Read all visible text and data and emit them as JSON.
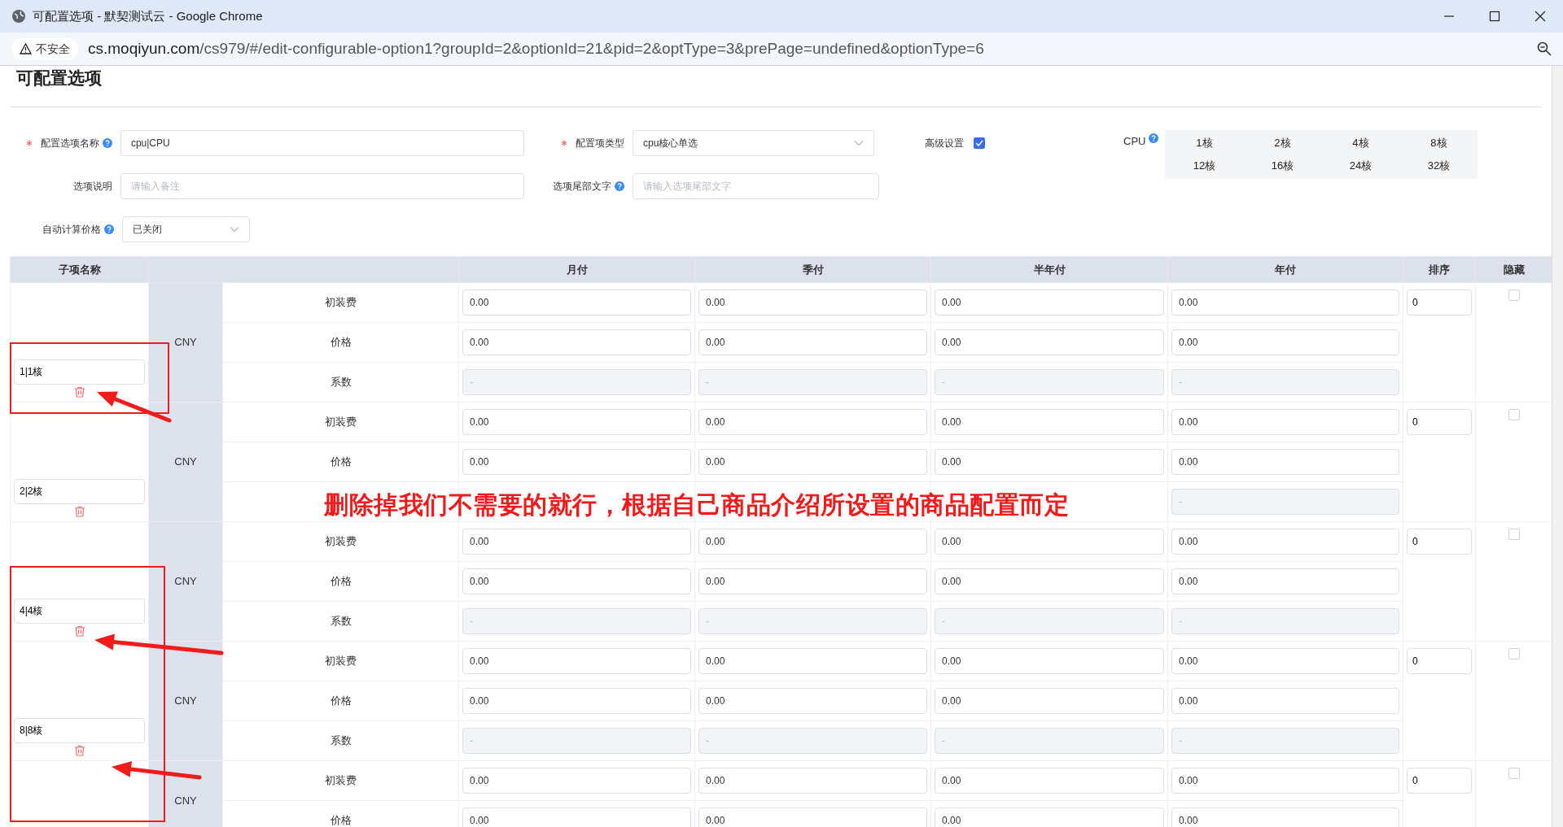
{
  "window": {
    "title": "可配置选项 - 默契测试云 - Google Chrome"
  },
  "address_bar": {
    "security": "不安全",
    "host": "cs.moqiyun.com",
    "path": "/cs979/#/edit-configurable-option1?groupId=2&optionId=21&pid=2&optType=3&prePage=undefined&optionType=6"
  },
  "page": {
    "title": "可配置选项"
  },
  "form": {
    "rows": [
      [
        {
          "kind": "input",
          "label": "配置选项名称",
          "required": true,
          "help": true,
          "value": "cpu|CPU"
        },
        {
          "kind": "select",
          "label": "配置项类型",
          "required": true,
          "help": false,
          "value": "cpu核心单选"
        }
      ],
      [
        {
          "kind": "input",
          "label": "选项说明",
          "required": false,
          "help": false,
          "placeholder": "请输入备注"
        },
        {
          "kind": "input",
          "label": "选项尾部文字",
          "required": false,
          "help": true,
          "placeholder": "请输入选项尾部文字"
        }
      ],
      [
        {
          "kind": "select",
          "label": "自动计算价格",
          "required": false,
          "help": true,
          "value": "已关闭"
        }
      ]
    ],
    "advanced": {
      "label": "高级设置",
      "checked": true
    },
    "cpu": {
      "label": "CPU",
      "help": true,
      "options": [
        "1核",
        "2核",
        "4核",
        "8核",
        "12核",
        "16核",
        "24核",
        "32核"
      ]
    }
  },
  "table": {
    "columns": [
      "子项名称",
      "月付",
      "季付",
      "半年付",
      "年付",
      "排序",
      "隐藏"
    ],
    "groups": [
      {
        "name": "1|1核",
        "currency": "CNY",
        "sort": "0",
        "hidden": false,
        "rows": [
          {
            "kind": "fee",
            "label": "初装费",
            "cells": [
              "0.00",
              "0.00",
              "0.00",
              "0.00"
            ]
          },
          {
            "kind": "fee",
            "label": "价格",
            "cells": [
              "0.00",
              "0.00",
              "0.00",
              "0.00"
            ]
          },
          {
            "kind": "coefficient",
            "label": "系数",
            "placeholders": [
              "-",
              "-",
              "-",
              "-"
            ]
          }
        ]
      },
      {
        "name": "2|2核",
        "currency": "CNY",
        "sort": "0",
        "hidden": false,
        "rows": [
          {
            "kind": "fee",
            "label": "初装费",
            "cells": [
              "0.00",
              "0.00",
              "0.00",
              "0.00"
            ]
          },
          {
            "kind": "fee",
            "label": "价格",
            "cells": [
              "0.00",
              "0.00",
              "0.00",
              "0.00"
            ]
          },
          {
            "kind": "coefficient",
            "placeholders": [
              "-"
            ]
          }
        ]
      },
      {
        "name": "4|4核",
        "currency": "CNY",
        "sort": "0",
        "hidden": false,
        "rows": [
          {
            "kind": "fee",
            "label": "初装费",
            "cells": [
              "0.00",
              "0.00",
              "0.00",
              "0.00"
            ]
          },
          {
            "kind": "fee",
            "label": "价格",
            "cells": [
              "0.00",
              "0.00",
              "0.00",
              "0.00"
            ]
          },
          {
            "kind": "coefficient",
            "label": "系数",
            "placeholders": [
              "-",
              "-",
              "-",
              "-"
            ]
          }
        ]
      },
      {
        "name": "8|8核",
        "currency": "CNY",
        "sort": "0",
        "hidden": false,
        "rows": [
          {
            "kind": "fee",
            "label": "初装费",
            "cells": [
              "0.00",
              "0.00",
              "0.00",
              "0.00"
            ]
          },
          {
            "kind": "fee",
            "label": "价格",
            "cells": [
              "0.00",
              "0.00",
              "0.00",
              "0.00"
            ]
          },
          {
            "kind": "coefficient",
            "label": "系数",
            "placeholders": [
              "-",
              "-",
              "-",
              "-"
            ]
          }
        ]
      },
      {
        "currency": "CNY",
        "sort": "0",
        "hidden": false,
        "rows": [
          {
            "kind": "fee",
            "label": "初装费",
            "cells": [
              "0.00",
              "0.00",
              "0.00",
              "0.00"
            ]
          },
          {
            "kind": "fee",
            "label": "价格",
            "cells": [
              "0.00",
              "0.00",
              "0.00",
              "0.00"
            ]
          }
        ]
      }
    ]
  },
  "annotation": {
    "text": "删除掉我们不需要的就行，根据自己商品介绍所设置的商品配置而定"
  }
}
